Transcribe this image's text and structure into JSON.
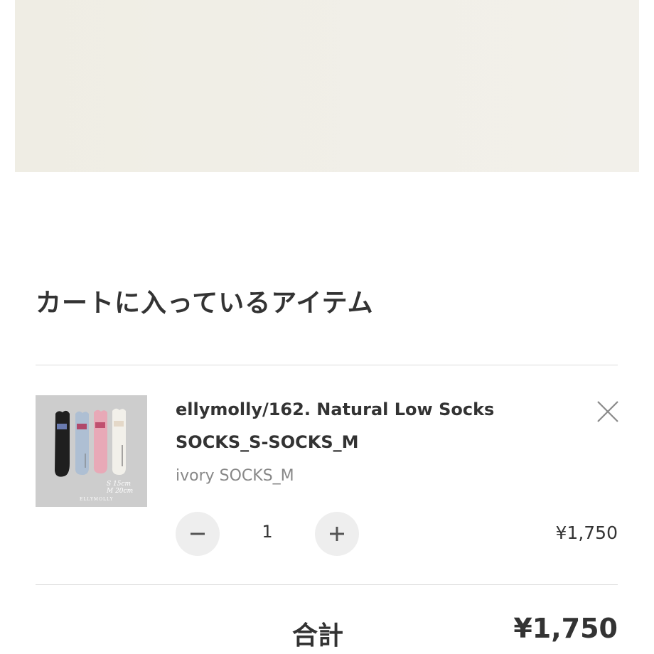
{
  "cart": {
    "title": "カートに入っているアイテム",
    "items": [
      {
        "name": "ellymolly/162. Natural Low Socks",
        "sku": "SOCKS_S-SOCKS_M",
        "variant": "ivory SOCKS_M",
        "quantity": "1",
        "price": "¥1,750",
        "thumbnail": {
          "size_text": "S 15cm\nM 20cm",
          "brand_text": "ELLYMOLLY"
        }
      }
    ],
    "total_label": "合計",
    "total_value": "¥1,750"
  },
  "icons": {
    "remove": "close-icon",
    "decrease": "minus-icon",
    "increase": "plus-icon"
  },
  "colors": {
    "banner": "#f0eee6",
    "text": "#333333",
    "muted": "#888888",
    "button_bg": "#eeeeee",
    "divider": "#dddddd"
  }
}
